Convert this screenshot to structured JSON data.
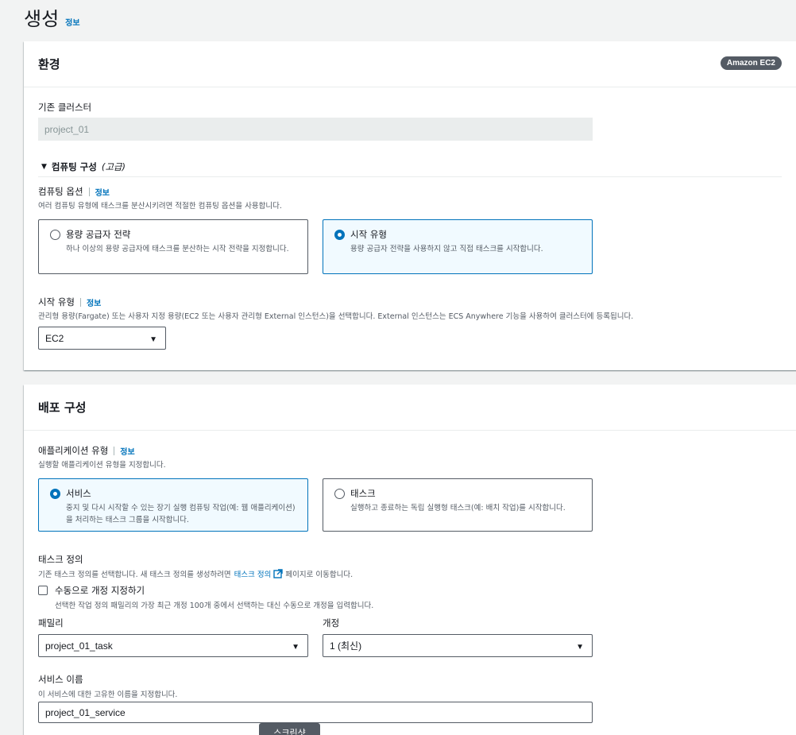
{
  "page": {
    "title": "생성",
    "info": "정보"
  },
  "environment": {
    "title": "환경",
    "badge": "Amazon EC2",
    "existing_cluster_label": "기존 클러스터",
    "existing_cluster_value": "project_01",
    "compute_config": {
      "title": "컴퓨팅 구성",
      "qualifier": "(고급)"
    },
    "compute_options": {
      "label": "컴퓨팅 옵션",
      "info": "정보",
      "desc": "여러 컴퓨팅 유형에 태스크를 분산시키려면 적절한 컴퓨팅 옵션을 사용합니다.",
      "tiles": [
        {
          "title": "용량 공급자 전략",
          "desc": "하나 이상의 용량 공급자에 태스크를 분산하는 시작 전략을 지정합니다.",
          "selected": false
        },
        {
          "title": "시작 유형",
          "desc": "용량 공급자 전략을 사용하지 않고 직접 태스크를 시작합니다.",
          "selected": true
        }
      ]
    },
    "launch_type": {
      "label": "시작 유형",
      "info": "정보",
      "desc": "관리형 용량(Fargate) 또는 사용자 지정 용량(EC2 또는 사용자 관리형 External 인스턴스)을 선택합니다. External 인스턴스는 ECS Anywhere 기능을 사용하여 클러스터에 등록됩니다.",
      "value": "EC2"
    }
  },
  "deployment": {
    "title": "배포 구성",
    "app_type": {
      "label": "애플리케이션 유형",
      "info": "정보",
      "desc": "실행할 애플리케이션 유형을 지정합니다.",
      "tiles": [
        {
          "title": "서비스",
          "desc": "중지 및 다시 시작할 수 있는 장기 실행 컴퓨팅 작업(예: 웹 애플리케이션)을 처리하는 태스크 그룹을 시작합니다.",
          "selected": true
        },
        {
          "title": "태스크",
          "desc": "실행하고 종료하는 독립 실행형 태스크(예: 배치 작업)를 시작합니다.",
          "selected": false
        }
      ]
    },
    "task_def": {
      "label": "태스크 정의",
      "desc_before": "기존 태스크 정의를 선택합니다. 새 태스크 정의를 생성하려면",
      "desc_link": "태스크 정의",
      "desc_after": "페이지로 이동합니다.",
      "manual_revision_label": "수동으로 개정 지정하기",
      "manual_revision_desc": "선택한 작업 정의 패밀리의 가장 최근 개정 100개 중에서 선택하는 대신 수동으로 개정을 입력합니다.",
      "family_label": "패밀리",
      "family_value": "project_01_task",
      "revision_label": "개정",
      "revision_value": "1 (최신)"
    },
    "service_name": {
      "label": "서비스 이름",
      "desc": "이 서비스에 대한 고유한 이름을 지정합니다.",
      "value": "project_01_service"
    }
  },
  "tooltip": "스크린샷",
  "colors": {
    "accent": "#0073bb",
    "badge": "#545b64",
    "selected_bg": "#f1faff"
  }
}
